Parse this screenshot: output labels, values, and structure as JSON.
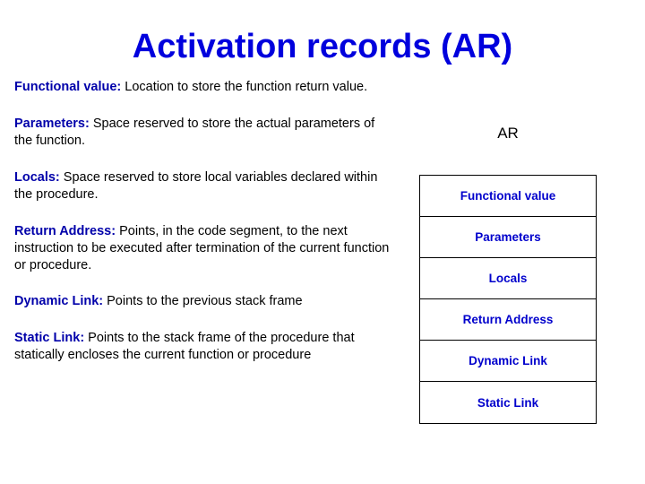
{
  "slide": {
    "title": "Activation records (AR)",
    "title_color": "#0000dd",
    "term_color": "#0000aa",
    "body_color": "#000000",
    "box_label_color": "#0000cc",
    "background_color": "#ffffff"
  },
  "definitions": [
    {
      "term": "Functional value:",
      "body": " Location to store the function return value."
    },
    {
      "term": "Parameters:",
      "body": " Space reserved  to store the actual parameters of the function."
    },
    {
      "term": "Locals:",
      "body": " Space reserved to store local variables declared  within the procedure."
    },
    {
      "term": "Return Address:",
      "body": " Points, in the code segment, to the next instruction to be executed after termination of the current function or procedure."
    },
    {
      "term": "Dynamic Link:",
      "body": " Points to the previous stack frame"
    },
    {
      "term": "Static Link:",
      "body": " Points to the stack frame  of the procedure that statically encloses the current function or procedure"
    }
  ],
  "diagram": {
    "caption": "AR",
    "rows": [
      {
        "label": "Functional value"
      },
      {
        "label": "Parameters"
      },
      {
        "label": "Locals"
      },
      {
        "label": "Return Address"
      },
      {
        "label": "Dynamic Link"
      },
      {
        "label": "Static Link"
      }
    ]
  }
}
